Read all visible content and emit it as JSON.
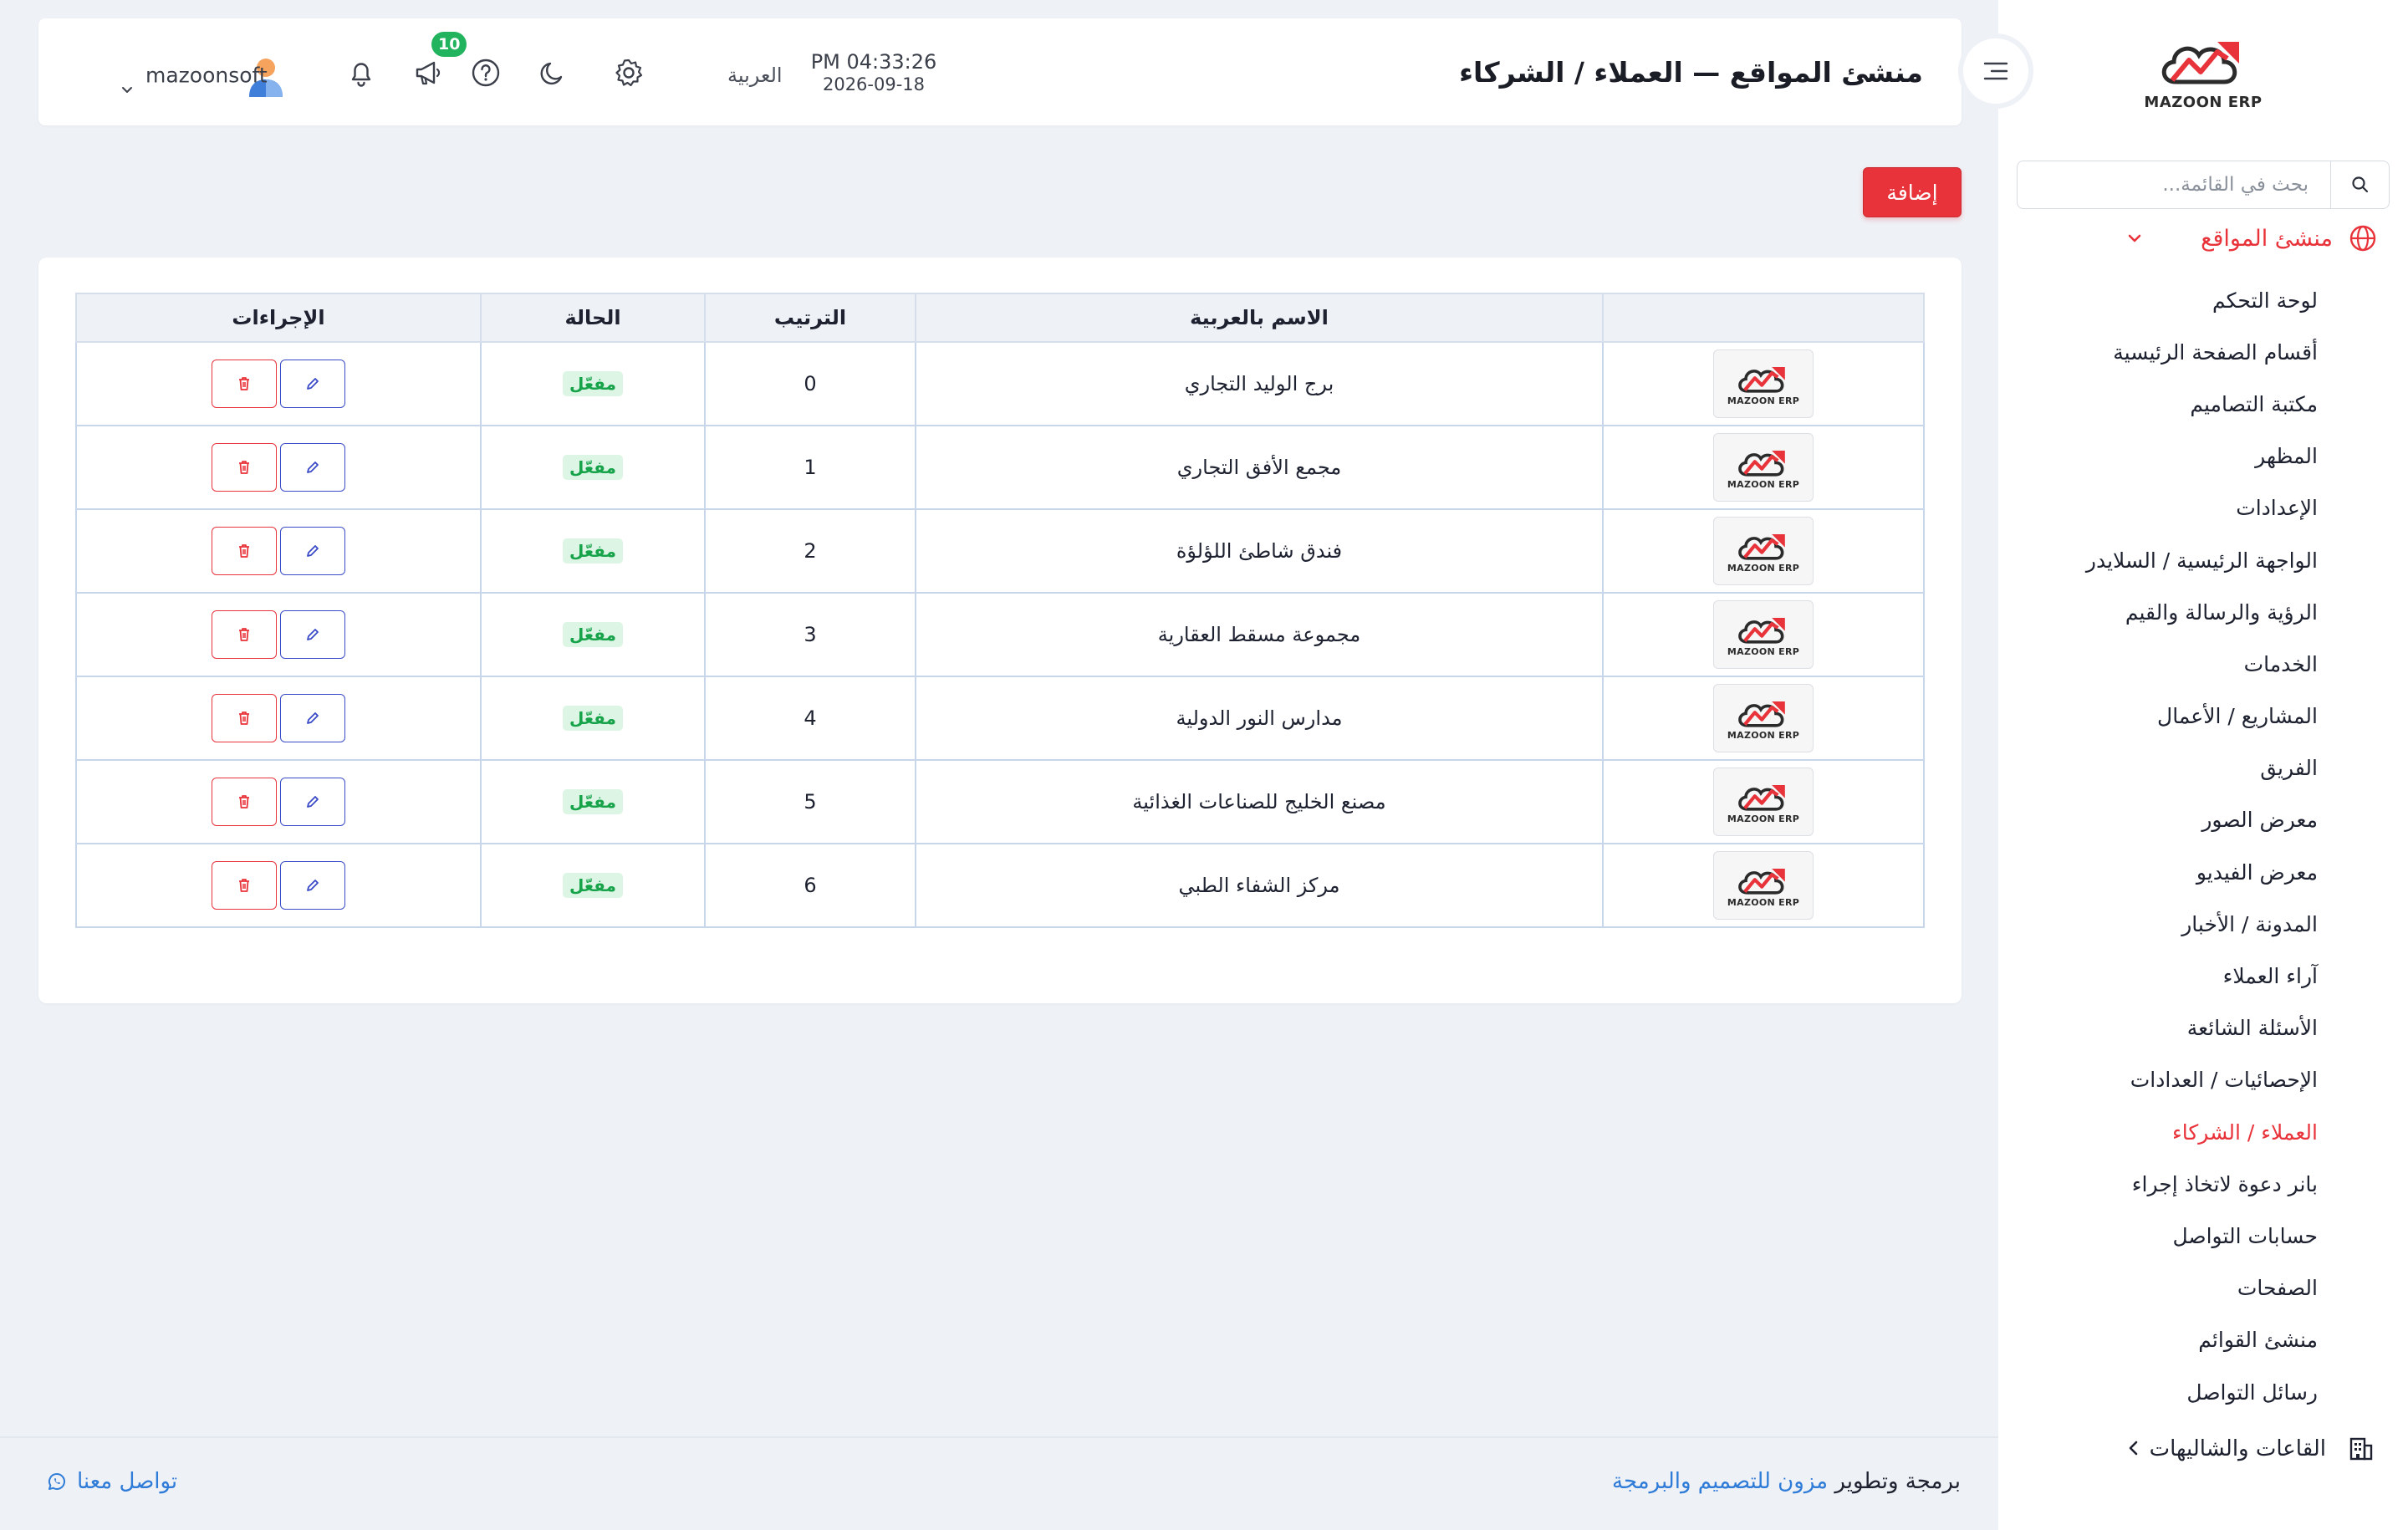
{
  "sidebar": {
    "logo_text": "MAZOON ERP",
    "search_placeholder": "بحث في القائمة...",
    "group": {
      "label": "منشئ المواقع"
    },
    "items": [
      {
        "label": "لوحة التحكم"
      },
      {
        "label": "أقسام الصفحة الرئيسية"
      },
      {
        "label": "مكتبة التصاميم"
      },
      {
        "label": "المظهر"
      },
      {
        "label": "الإعدادات"
      },
      {
        "label": "الواجهة الرئيسية / السلايدر"
      },
      {
        "label": "الرؤية والرسالة والقيم"
      },
      {
        "label": "الخدمات"
      },
      {
        "label": "المشاريع / الأعمال"
      },
      {
        "label": "الفريق"
      },
      {
        "label": "معرض الصور"
      },
      {
        "label": "معرض الفيديو"
      },
      {
        "label": "المدونة / الأخبار"
      },
      {
        "label": "آراء العملاء"
      },
      {
        "label": "الأسئلة الشائعة"
      },
      {
        "label": "الإحصائيات / العدادات"
      },
      {
        "label": "العملاء / الشركاء",
        "active": true
      },
      {
        "label": "بانر دعوة لاتخاذ إجراء"
      },
      {
        "label": "حسابات التواصل"
      },
      {
        "label": "الصفحات"
      },
      {
        "label": "منشئ القوائم"
      },
      {
        "label": "رسائل التواصل"
      }
    ],
    "bottom_group": {
      "label": "القاعات والشاليهات"
    }
  },
  "header": {
    "title": "منشئ المواقع — العملاء / الشركاء",
    "time": "PM 04:33:26",
    "date": "2026-09-18",
    "language": "العربية",
    "notification_count": "10",
    "username": "mazoonsoft"
  },
  "toolbar": {
    "add_label": "إضافة"
  },
  "table": {
    "columns": [
      "",
      "الاسم بالعربية",
      "الترتيب",
      "الحالة",
      "الإجراءات"
    ],
    "thumb_text": "MAZOON ERP",
    "rows": [
      {
        "name": "برج الوليد التجاري",
        "order": "0",
        "status": "مفعّل"
      },
      {
        "name": "مجمع الأفق التجاري",
        "order": "1",
        "status": "مفعّل"
      },
      {
        "name": "فندق شاطئ اللؤلؤة",
        "order": "2",
        "status": "مفعّل"
      },
      {
        "name": "مجموعة مسقط العقارية",
        "order": "3",
        "status": "مفعّل"
      },
      {
        "name": "مدارس النور الدولية",
        "order": "4",
        "status": "مفعّل"
      },
      {
        "name": "مصنع الخليج للصناعات الغذائية",
        "order": "5",
        "status": "مفعّل"
      },
      {
        "name": "مركز الشفاء الطبي",
        "order": "6",
        "status": "مفعّل"
      }
    ]
  },
  "footer": {
    "contact": "تواصل معنا",
    "credit_prefix": "برمجة وتطوير",
    "credit_link": "مزون للتصميم والبرمجة"
  },
  "colors": {
    "accent": "#e8333a",
    "link": "#2f7bd8",
    "success": "#17a34a",
    "edit": "#3b4bc8",
    "page_bg": "#eef1f6"
  },
  "icons": {
    "search": "search-icon",
    "group": "globe-icon",
    "collapse": "menu-lines-icon",
    "settings": "gear-icon",
    "theme": "moon-icon",
    "help": "question-circle-icon",
    "announcements": "megaphone-icon",
    "notifications": "bell-icon",
    "user": "user-avatar-icon",
    "edit": "pencil-icon",
    "delete": "trash-icon",
    "whatsapp": "whatsapp-icon",
    "bottom_group": "building-icon"
  }
}
